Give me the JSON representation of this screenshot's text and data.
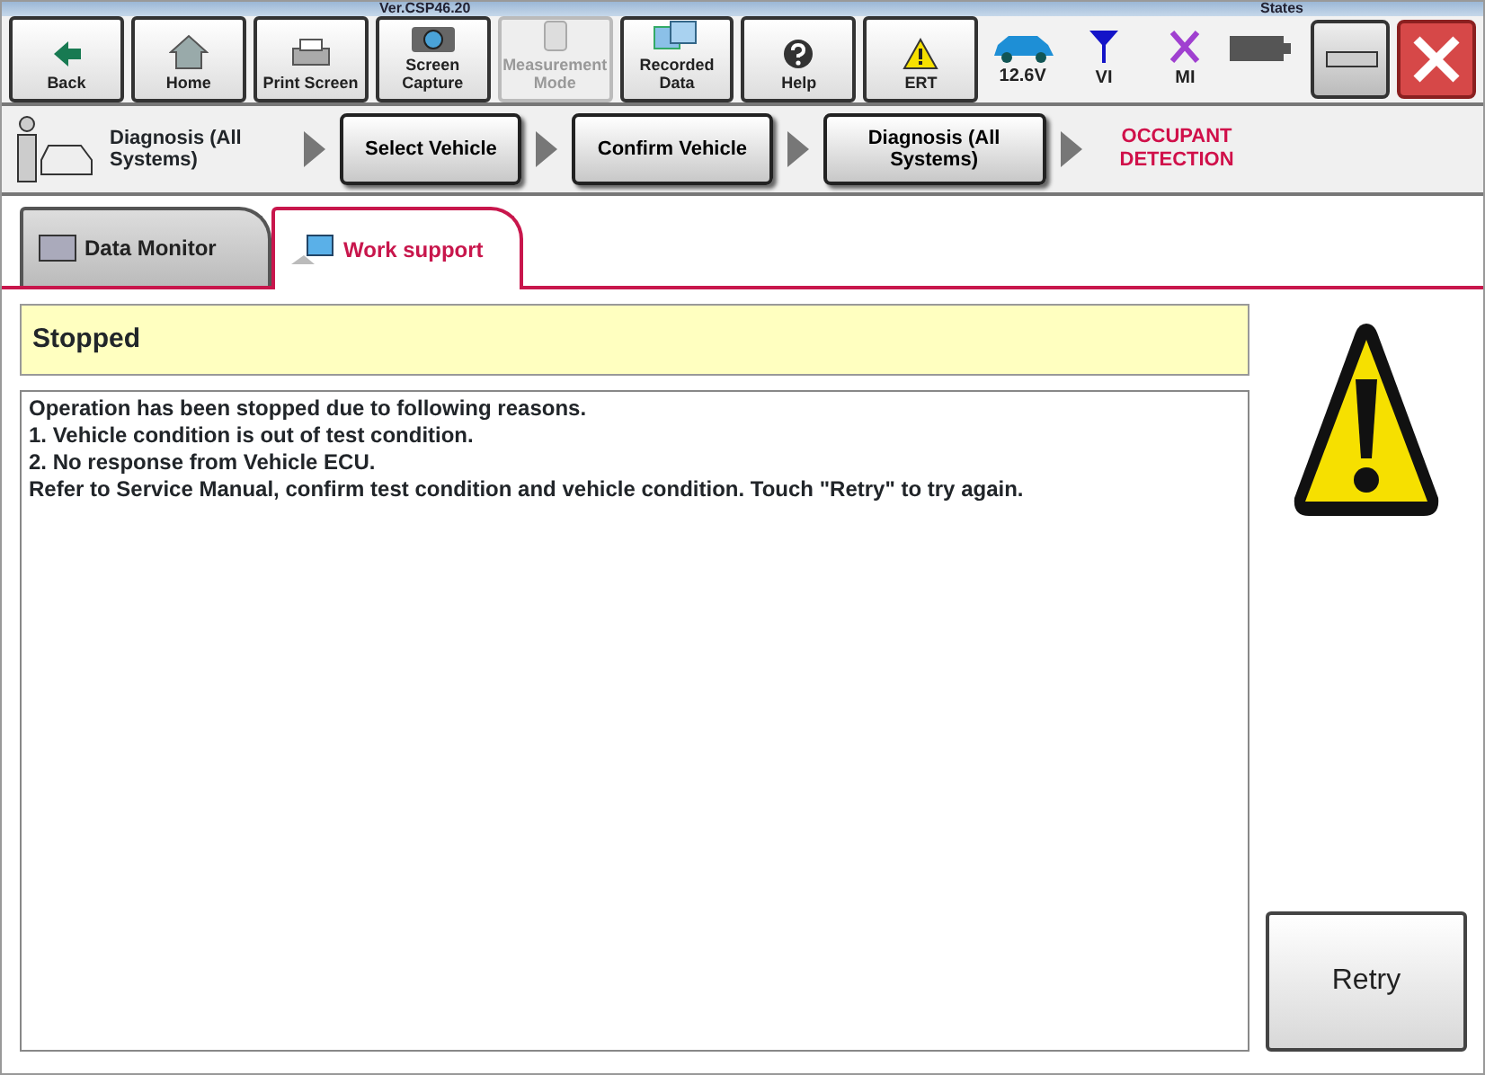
{
  "header": {
    "version": "Ver.CSP46.20",
    "states_label": "States"
  },
  "toolbar": [
    {
      "label": "Back",
      "disabled": false
    },
    {
      "label": "Home",
      "disabled": false
    },
    {
      "label": "Print Screen",
      "disabled": false
    },
    {
      "label": "Screen Capture",
      "disabled": false
    },
    {
      "label": "Measurement Mode",
      "disabled": true
    },
    {
      "label": "Recorded Data",
      "disabled": false
    },
    {
      "label": "Help",
      "disabled": false
    },
    {
      "label": "ERT",
      "disabled": false
    }
  ],
  "indicators": [
    "12.6V",
    "VI",
    "MI"
  ],
  "breadcrumb": {
    "current_section": "Diagnosis (All Systems)",
    "steps": [
      "Select Vehicle",
      "Confirm Vehicle",
      "Diagnosis (All Systems)"
    ],
    "location": "OCCUPANT DETECTION"
  },
  "tabs": [
    {
      "label": "Data Monitor",
      "selected": false
    },
    {
      "label": "Work support",
      "selected": true
    }
  ],
  "status": "Stopped",
  "message_lines": [
    "Operation has been stopped due to following reasons.",
    "1. Vehicle condition is out of test condition.",
    "2. No response from Vehicle ECU.",
    "Refer to Service Manual, confirm test condition and vehicle condition. Touch \"Retry\" to try again."
  ],
  "retry_button": "Retry"
}
